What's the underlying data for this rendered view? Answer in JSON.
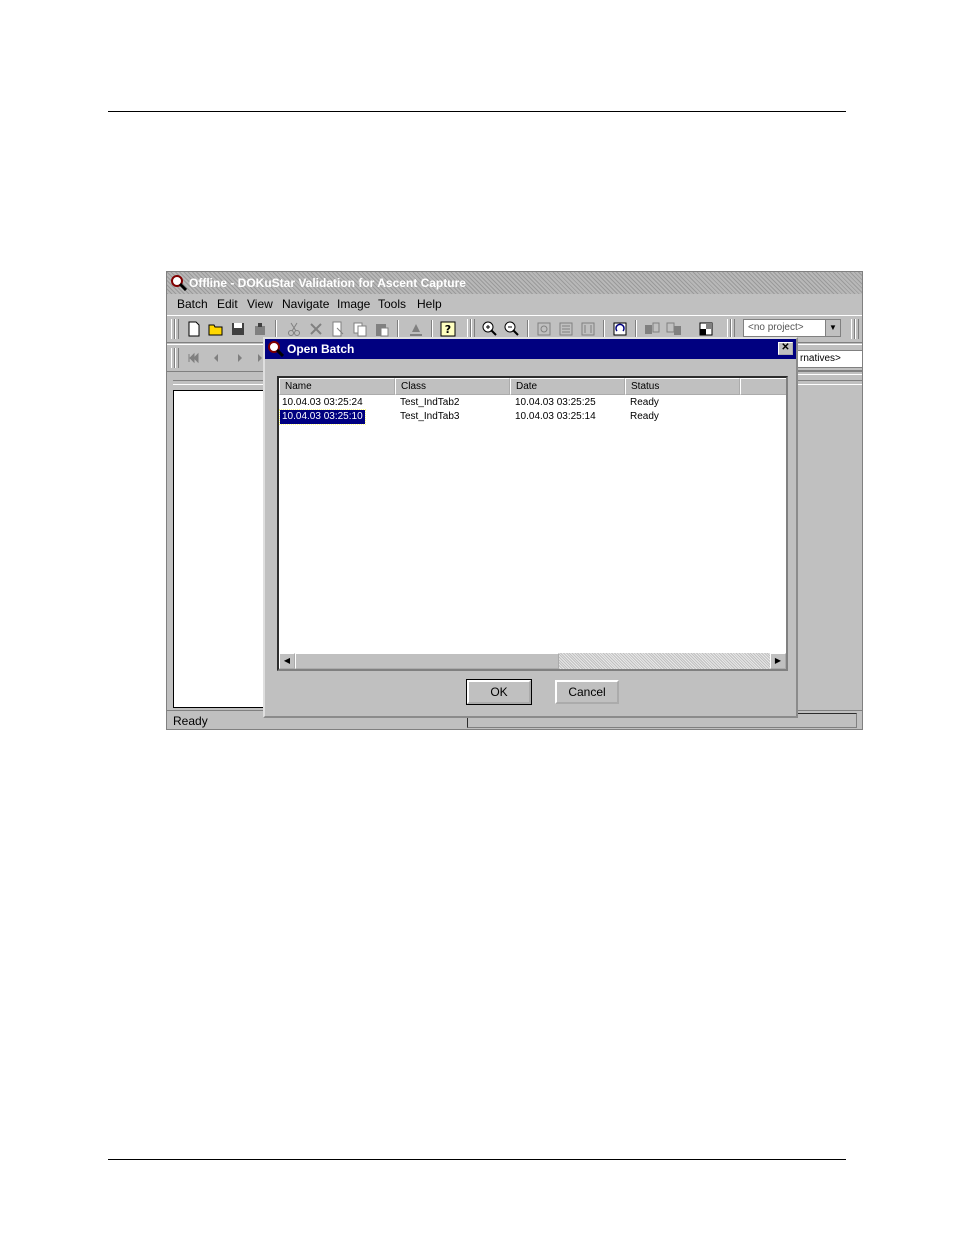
{
  "app": {
    "title": "Offline - DOKuStar Validation for Ascent Capture",
    "menu": [
      "Batch",
      "Edit",
      "View",
      "Navigate",
      "Image",
      "Tools",
      "Help"
    ],
    "project_combo": "<no project>",
    "alternatives_field": "rnatives>",
    "status": "Ready"
  },
  "dialog": {
    "title": "Open Batch",
    "close_glyph": "✕",
    "columns": [
      "Name",
      "Class",
      "Date",
      "Status"
    ],
    "rows": [
      {
        "name": "10.04.03 03:25:24",
        "class": "Test_IndTab2",
        "date": "10.04.03 03:25:25",
        "status": "Ready"
      },
      {
        "name": "10.04.03 03:25:10",
        "class": "Test_IndTab3",
        "date": "10.04.03 03:25:14",
        "status": "Ready"
      }
    ],
    "selected_row": 1,
    "ok_label": "OK",
    "cancel_label": "Cancel"
  }
}
